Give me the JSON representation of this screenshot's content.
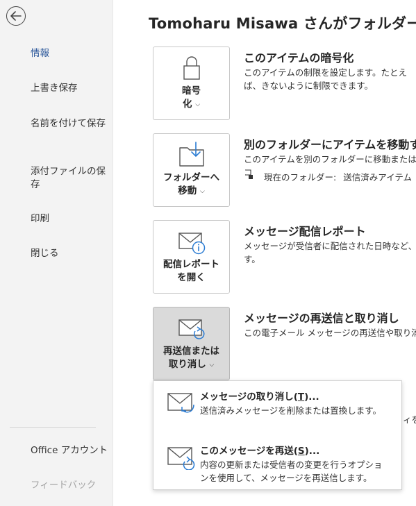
{
  "sidebar": {
    "back_icon": "back-arrow-icon",
    "items": [
      {
        "label": "情報",
        "active": true
      },
      {
        "label": "上書き保存"
      },
      {
        "label": "名前を付けて保存"
      },
      {
        "label": "添付ファイルの保存"
      },
      {
        "label": "印刷"
      },
      {
        "label": "閉じる"
      }
    ],
    "bottom_items": [
      {
        "label": "Office アカウント"
      },
      {
        "label": "フィードバック",
        "disabled": true
      }
    ]
  },
  "main": {
    "title": "Tomoharu Misawa さんがフォルダー",
    "sections": [
      {
        "button": {
          "label_line1": "暗号",
          "label_line2": "化",
          "icon": "lock-icon"
        },
        "heading": "このアイテムの暗号化",
        "description": "このアイテムの制限を設定します。たとえば、きないように制限できます。"
      },
      {
        "button": {
          "label_line1": "フォルダーへ",
          "label_line2": "移動",
          "icon": "move-to-folder-icon"
        },
        "heading": "別のフォルダーにアイテムを移動す",
        "description": "このアイテムを別のフォルダーに移動またはコ",
        "bullet_label": "現在のフォルダー:",
        "bullet_value": "送信済みアイテム"
      },
      {
        "button": {
          "label_line1": "配信レポート",
          "label_line2": "を開く",
          "icon": "delivery-report-icon"
        },
        "heading": "メッセージ配信レポート",
        "description": "メッセージが受信者に配信された日時など、す。"
      },
      {
        "button": {
          "label_line1": "再送信または",
          "label_line2": "取り消し",
          "icon": "resend-recall-icon"
        },
        "heading": "メッセージの再送信と取り消し",
        "description": "この電子メール メッセージの再送信や取り消"
      }
    ],
    "peek_text": "ィを"
  },
  "menu": {
    "items": [
      {
        "title_pre": "メッセージの取り消し(",
        "title_key": "T",
        "title_post": ")...",
        "description": "送信済みメッセージを削除または置換します。",
        "icon": "recall-message-icon"
      },
      {
        "title_pre": "このメッセージを再送(",
        "title_key": "S",
        "title_post": ")...",
        "description": "内容の更新または受信者の変更を行うオプションを使用して、メッセージを再送信します。",
        "icon": "resend-message-icon"
      }
    ]
  },
  "colors": {
    "accent": "#2b579a",
    "sidebar_bg": "#f3f3f3",
    "pressed_bg": "#dadada"
  }
}
